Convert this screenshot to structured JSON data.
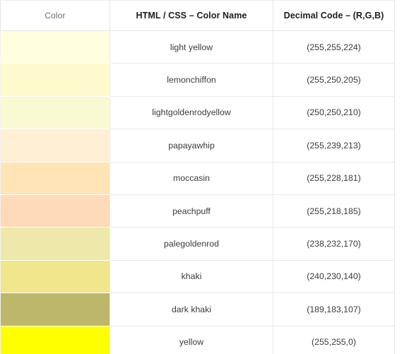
{
  "table": {
    "headers": [
      {
        "label": "Color",
        "name": "column-header-color"
      },
      {
        "label": "HTML / CSS – Color Name",
        "name": "column-header-html-css-color-name"
      },
      {
        "label": "Decimal Code – (R,G,B)",
        "name": "column-header-decimal-code"
      }
    ],
    "rows": [
      {
        "swatch_hex": "#FFFFE0",
        "color_name": "light yellow",
        "decimal_code": "(255,255,224)"
      },
      {
        "swatch_hex": "#FFFACD",
        "color_name": "lemonchiffon",
        "decimal_code": "(255,250,205)"
      },
      {
        "swatch_hex": "#FAFAD2",
        "color_name": "lightgoldenrodyellow",
        "decimal_code": "(250,250,210)"
      },
      {
        "swatch_hex": "#FFEFD5",
        "color_name": "papayawhip",
        "decimal_code": "(255,239,213)"
      },
      {
        "swatch_hex": "#FFE4B5",
        "color_name": "moccasin",
        "decimal_code": "(255,228,181)"
      },
      {
        "swatch_hex": "#FFDAB9",
        "color_name": "peachpuff",
        "decimal_code": "(255,218,185)"
      },
      {
        "swatch_hex": "#EEE8AA",
        "color_name": "palegoldenrod",
        "decimal_code": "(238,232,170)"
      },
      {
        "swatch_hex": "#F0E68C",
        "color_name": "khaki",
        "decimal_code": "(240,230,140)"
      },
      {
        "swatch_hex": "#BDB76B",
        "color_name": "dark khaki",
        "decimal_code": "(189,183,107)"
      },
      {
        "swatch_hex": "#FFFF00",
        "color_name": "yellow",
        "decimal_code": "(255,255,0)"
      }
    ]
  }
}
